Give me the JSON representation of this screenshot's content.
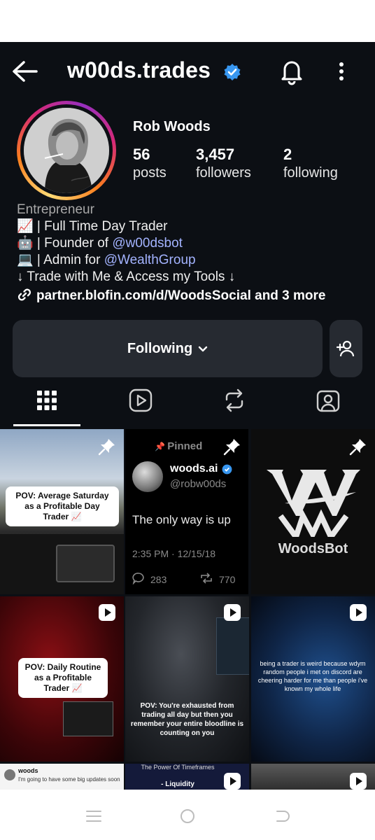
{
  "header": {
    "handle": "w00ds.trades"
  },
  "profile": {
    "display_name": "Rob Woods",
    "stats": [
      {
        "value": "56",
        "label": "posts"
      },
      {
        "value": "3,457",
        "label": "followers"
      },
      {
        "value": "2",
        "label": "following"
      }
    ],
    "bio": {
      "category": "Entrepreneur",
      "line1": "📈 | Full Time Day Trader",
      "line2_prefix": "🤖 | Founder of ",
      "line2_mention": "@w00dsbot",
      "line3_prefix": "💻 | Admin for ",
      "line3_mention": "@WealthGroup",
      "line4": "↓ Trade with Me & Access my Tools ↓",
      "link": "partner.blofin.com/d/WoodsSocial and 3 more"
    }
  },
  "actions": {
    "following_label": "Following"
  },
  "grid": {
    "post1_caption": "POV: Average Saturday as a Profitable Day Trader 📈",
    "post2": {
      "pinned_label": "Pinned",
      "name": "woods.ai",
      "handle": "@robw00ds",
      "text": "The only way is up",
      "time": "2:35 PM · 12/15/18",
      "replies": "283",
      "retweets": "770"
    },
    "post3_brand": "WoodsBot",
    "post4_caption": "POV: Daily Routine as a Profitable Trader 📈",
    "post5_caption": "POV: You're exhausted from trading all day but then you remember your entire bloodline is counting on you",
    "post6_caption": "being a trader is weird because wdym random people i met on discord are cheering harder for me than people i've known my whole life",
    "post7_text": "woods",
    "post7_sub": "I'm going to have some big updates soon",
    "post8_title": "The Power Of Timeframes",
    "post8_sub": "- Liquidity"
  },
  "colors": {
    "background": "#0c0f14",
    "button": "#262a31",
    "verified": "#3897f0",
    "mention": "#a3b3ff"
  }
}
